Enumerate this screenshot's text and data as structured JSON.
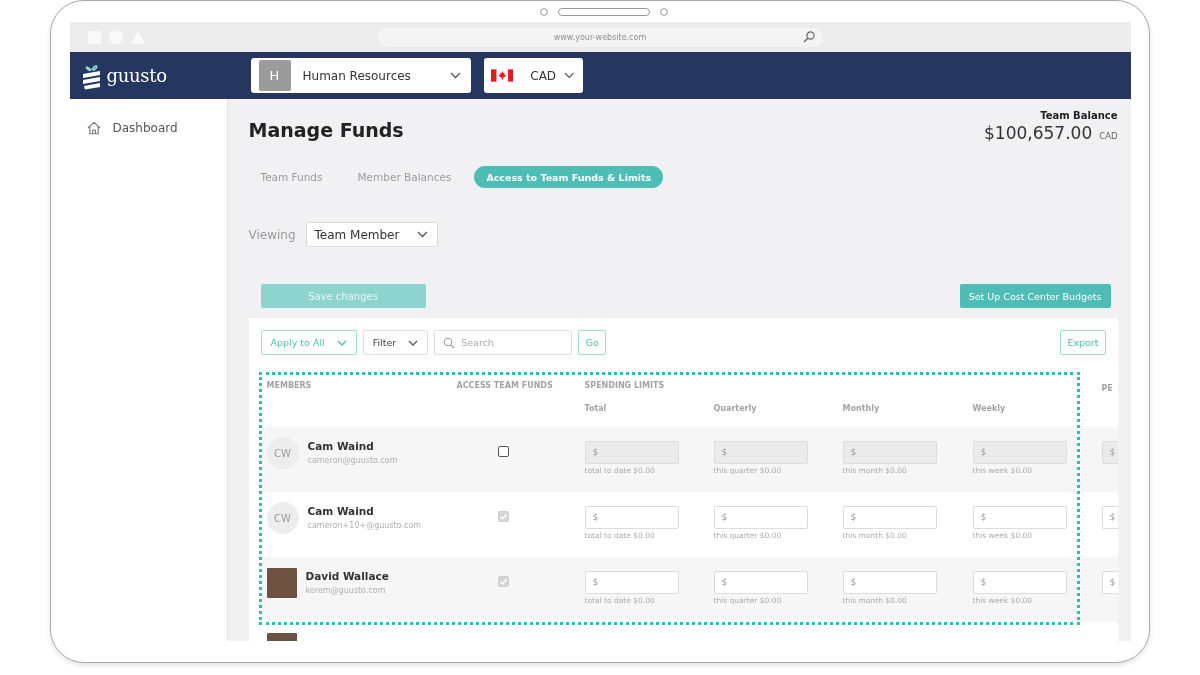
{
  "device": {
    "url": "www.your-website.com"
  },
  "header": {
    "logo": "guusto",
    "org": {
      "initial": "H",
      "name": "Human Resources"
    },
    "currency": "CAD"
  },
  "sidebar": {
    "items": [
      {
        "label": "Dashboard"
      }
    ]
  },
  "page": {
    "title": "Manage Funds",
    "balance": {
      "label": "Team Balance",
      "amount": "$100,657.00",
      "currency": "CAD"
    }
  },
  "tabs": [
    {
      "label": "Team Funds",
      "selected": false
    },
    {
      "label": "Member Balances",
      "selected": false
    },
    {
      "label": "Access to Team Funds & Limits",
      "selected": true
    }
  ],
  "viewing": {
    "label": "Viewing",
    "value": "Team Member"
  },
  "actions": {
    "save": {
      "label": "Save changes",
      "disabled": true
    },
    "budgets": {
      "label": "Set Up Cost Center Budgets"
    }
  },
  "toolbar": {
    "apply": "Apply to All",
    "filter": "Filter",
    "search": {
      "placeholder": "Search"
    },
    "go": "Go",
    "export": "Export"
  },
  "table": {
    "columns": {
      "members": "MEMBERS",
      "access": "ACCESS TEAM FUNDS",
      "limits": "SPENDING LIMITS",
      "column_5": "PE"
    },
    "periods": [
      "Total",
      "Quarterly",
      "Monthly",
      "Weekly"
    ],
    "rows": [
      {
        "avatar": {
          "kind": "initials",
          "text": "CW"
        },
        "name": "Cam Waind",
        "email": "cameron@guusto.com",
        "checked": false,
        "limits": [
          {
            "prefix": "$",
            "caption": "total to date $0.00"
          },
          {
            "prefix": "$",
            "caption": "this quarter $0.00"
          },
          {
            "prefix": "$",
            "caption": "this month $0.00"
          },
          {
            "prefix": "$",
            "caption": "this week $0.00"
          }
        ],
        "column_5": {
          "prefix": "$"
        }
      },
      {
        "avatar": {
          "kind": "initials",
          "text": "CW"
        },
        "name": "Cam Waind",
        "email": "cameron+10+@guusto.com",
        "checked": true,
        "limits": [
          {
            "prefix": "$",
            "caption": "total to date $0.00"
          },
          {
            "prefix": "$",
            "caption": "this quarter $0.00"
          },
          {
            "prefix": "$",
            "caption": "this month $0.00"
          },
          {
            "prefix": "$",
            "caption": "this week $0.00"
          }
        ],
        "column_5": {
          "prefix": "$"
        }
      },
      {
        "avatar": {
          "kind": "photo"
        },
        "name": "David Wallace",
        "email": "kerem@guusto.com",
        "checked": true,
        "limits": [
          {
            "prefix": "$",
            "caption": "total to date $0.00"
          },
          {
            "prefix": "$",
            "caption": "this quarter $0.00"
          },
          {
            "prefix": "$",
            "caption": "this month $0.00"
          },
          {
            "prefix": "$",
            "caption": "this week $0.00"
          }
        ],
        "column_5": {
          "prefix": "$"
        }
      }
    ],
    "partial_row": {
      "avatar": {
        "kind": "photo"
      }
    }
  }
}
